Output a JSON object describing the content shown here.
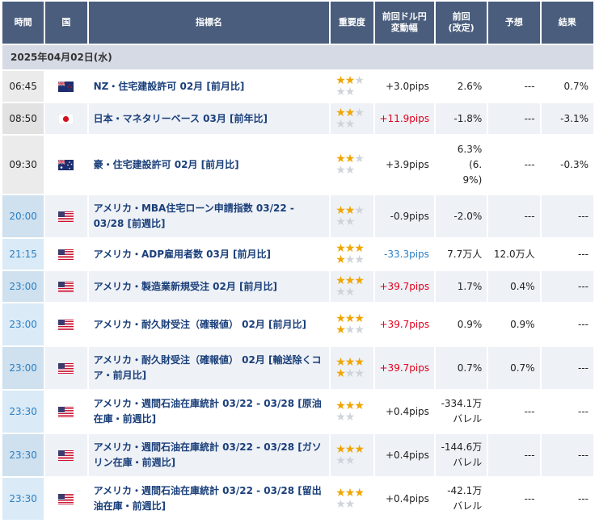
{
  "headers": {
    "time": "時間",
    "country": "国",
    "indicator": "指標名",
    "importance": "重要度",
    "change_line1": "前回ドル円",
    "change_line2": "変動幅",
    "previous_line1": "前回",
    "previous_line2": "(改定)",
    "forecast": "予想",
    "result": "結果"
  },
  "date_label": "2025年04月02日(水)",
  "colors": {
    "header_bg": "#4a5d7c",
    "date_row_bg": "#d6dae4",
    "link": "#1a3f7a",
    "positive": "#e0001b",
    "negative": "#2a7fc4",
    "star": "#f0a500"
  },
  "rows": [
    {
      "time": "06:45",
      "flag": "nz-flag-icon",
      "name": "NZ・住宅建設許可 02月 [前月比]",
      "stars": 2,
      "change": "+3.0pips",
      "previous": "2.6%",
      "forecast": "---",
      "result": "0.7%"
    },
    {
      "time": "08:50",
      "flag": "jp-flag-icon",
      "name": "日本・マネタリーベース 03月 [前年比]",
      "stars": 2,
      "change": "+11.9pips",
      "previous": "-1.8%",
      "forecast": "---",
      "result": "-3.1%"
    },
    {
      "time": "09:30",
      "flag": "au-flag-icon",
      "name": "豪・住宅建設許可 02月 [前月比]",
      "stars": 2,
      "change": "+3.9pips",
      "previous": "6.3%\n(6.\n9%)",
      "forecast": "---",
      "result": "-0.3%"
    },
    {
      "time": "20:00",
      "flag": "us-flag-icon",
      "name": "アメリカ・MBA住宅ローン申請指数 03/22 - 03/28 [前週比]",
      "stars": 2,
      "change": "-0.9pips",
      "previous": "-2.0%",
      "forecast": "---",
      "result": "---"
    },
    {
      "time": "21:15",
      "flag": "us-flag-icon",
      "name": "アメリカ・ADP雇用者数 03月 [前月比]",
      "stars": 4,
      "change": "-33.3pips",
      "previous": "7.7万人",
      "forecast": "12.0万人",
      "result": "---"
    },
    {
      "time": "23:00",
      "flag": "us-flag-icon",
      "name": "アメリカ・製造業新規受注 02月 [前月比]",
      "stars": 3,
      "change": "+39.7pips",
      "previous": "1.7%",
      "forecast": "0.4%",
      "result": "---"
    },
    {
      "time": "23:00",
      "flag": "us-flag-icon",
      "name": "アメリカ・耐久財受注（確報値） 02月 [前月比]",
      "stars": 4,
      "change": "+39.7pips",
      "previous": "0.9%",
      "forecast": "0.9%",
      "result": "---"
    },
    {
      "time": "23:00",
      "flag": "us-flag-icon",
      "name": "アメリカ・耐久財受注（確報値） 02月 [輸送除くコア・前月比]",
      "stars": 4,
      "change": "+39.7pips",
      "previous": "0.7%",
      "forecast": "0.7%",
      "result": "---"
    },
    {
      "time": "23:30",
      "flag": "us-flag-icon",
      "name": "アメリカ・週間石油在庫統計 03/22 - 03/28 [原油在庫・前週比]",
      "stars": 3,
      "change": "+0.4pips",
      "previous": "-334.1万\nバレル",
      "forecast": "---",
      "result": "---"
    },
    {
      "time": "23:30",
      "flag": "us-flag-icon",
      "name": "アメリカ・週間石油在庫統計 03/22 - 03/28 [ガソリン在庫・前週比]",
      "stars": 3,
      "change": "+0.4pips",
      "previous": "-144.6万\nバレル",
      "forecast": "---",
      "result": "---"
    },
    {
      "time": "23:30",
      "flag": "us-flag-icon",
      "name": "アメリカ・週間石油在庫統計 03/22 - 03/28 [留出油在庫・前週比]",
      "stars": 3,
      "change": "+0.4pips",
      "previous": "-42.1万\nバレル",
      "forecast": "---",
      "result": "---"
    }
  ]
}
